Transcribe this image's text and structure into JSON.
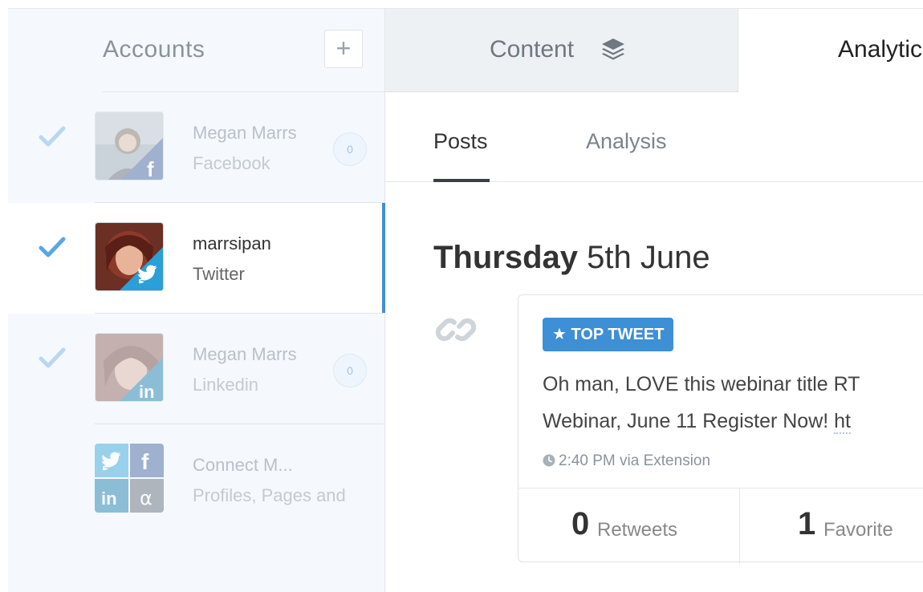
{
  "sidebar": {
    "title": "Accounts",
    "add_label": "+",
    "accounts": [
      {
        "name": "Megan Marrs",
        "network": "Facebook",
        "count": "0",
        "selected": false
      },
      {
        "name": "marrsipan",
        "network": "Twitter",
        "selected": true
      },
      {
        "name": "Megan Marrs",
        "network": "Linkedin",
        "count": "0",
        "selected": false
      },
      {
        "name": "Connect M...",
        "network": "Profiles, Pages and"
      }
    ]
  },
  "tabs": {
    "content": "Content",
    "analytics": "Analytics"
  },
  "subtabs": {
    "posts": "Posts",
    "analysis": "Analysis"
  },
  "main": {
    "date_day": "Thursday",
    "date_rest": " 5th June",
    "post": {
      "badge": "★ TOP TWEET",
      "line1": "Oh man, LOVE this webinar title RT",
      "line2_pre": "Webinar, June 11 Register Now! ",
      "line2_url": "ht",
      "meta": "2:40 PM via Extension",
      "retweets_count": "0",
      "retweets_label": "Retweets",
      "favorites_count": "1",
      "favorites_label": "Favorite"
    }
  },
  "colors": {
    "accent": "#3d8fd6",
    "sidebar_bg": "#f5f9fd",
    "tab_bg": "#eef1f4"
  }
}
